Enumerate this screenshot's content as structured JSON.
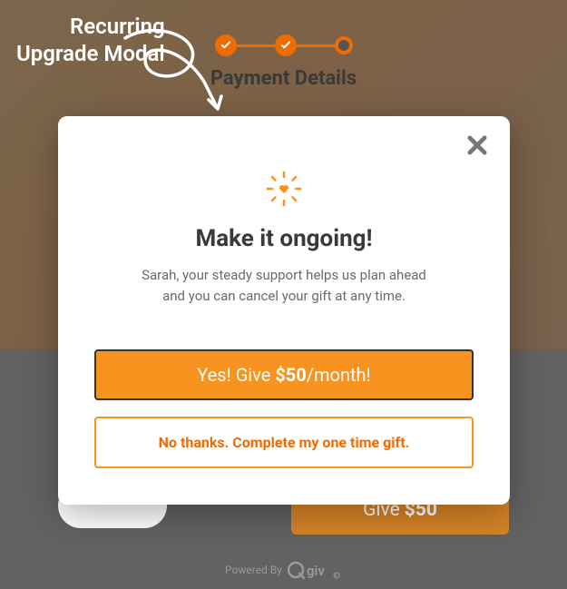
{
  "annotation": {
    "line1": "Recurring",
    "line2": "Upgrade Modal"
  },
  "stepper": {
    "current_label": "Payment Details"
  },
  "background_actions": {
    "give_prefix": "Give",
    "give_amount": "$50",
    "powered_by": "Powered By",
    "powered_brand": "Qgiv"
  },
  "modal": {
    "title": "Make it ongoing!",
    "body": "Sarah, your steady support helps us plan ahead and you can cancel your gift at any time.",
    "primary_prefix": "Yes! Give",
    "primary_amount": "$50",
    "primary_suffix": "/month!",
    "secondary": "No thanks. Complete my one time gift."
  },
  "colors": {
    "accent": "#f7931e",
    "accent_dark": "#ef6c00"
  }
}
